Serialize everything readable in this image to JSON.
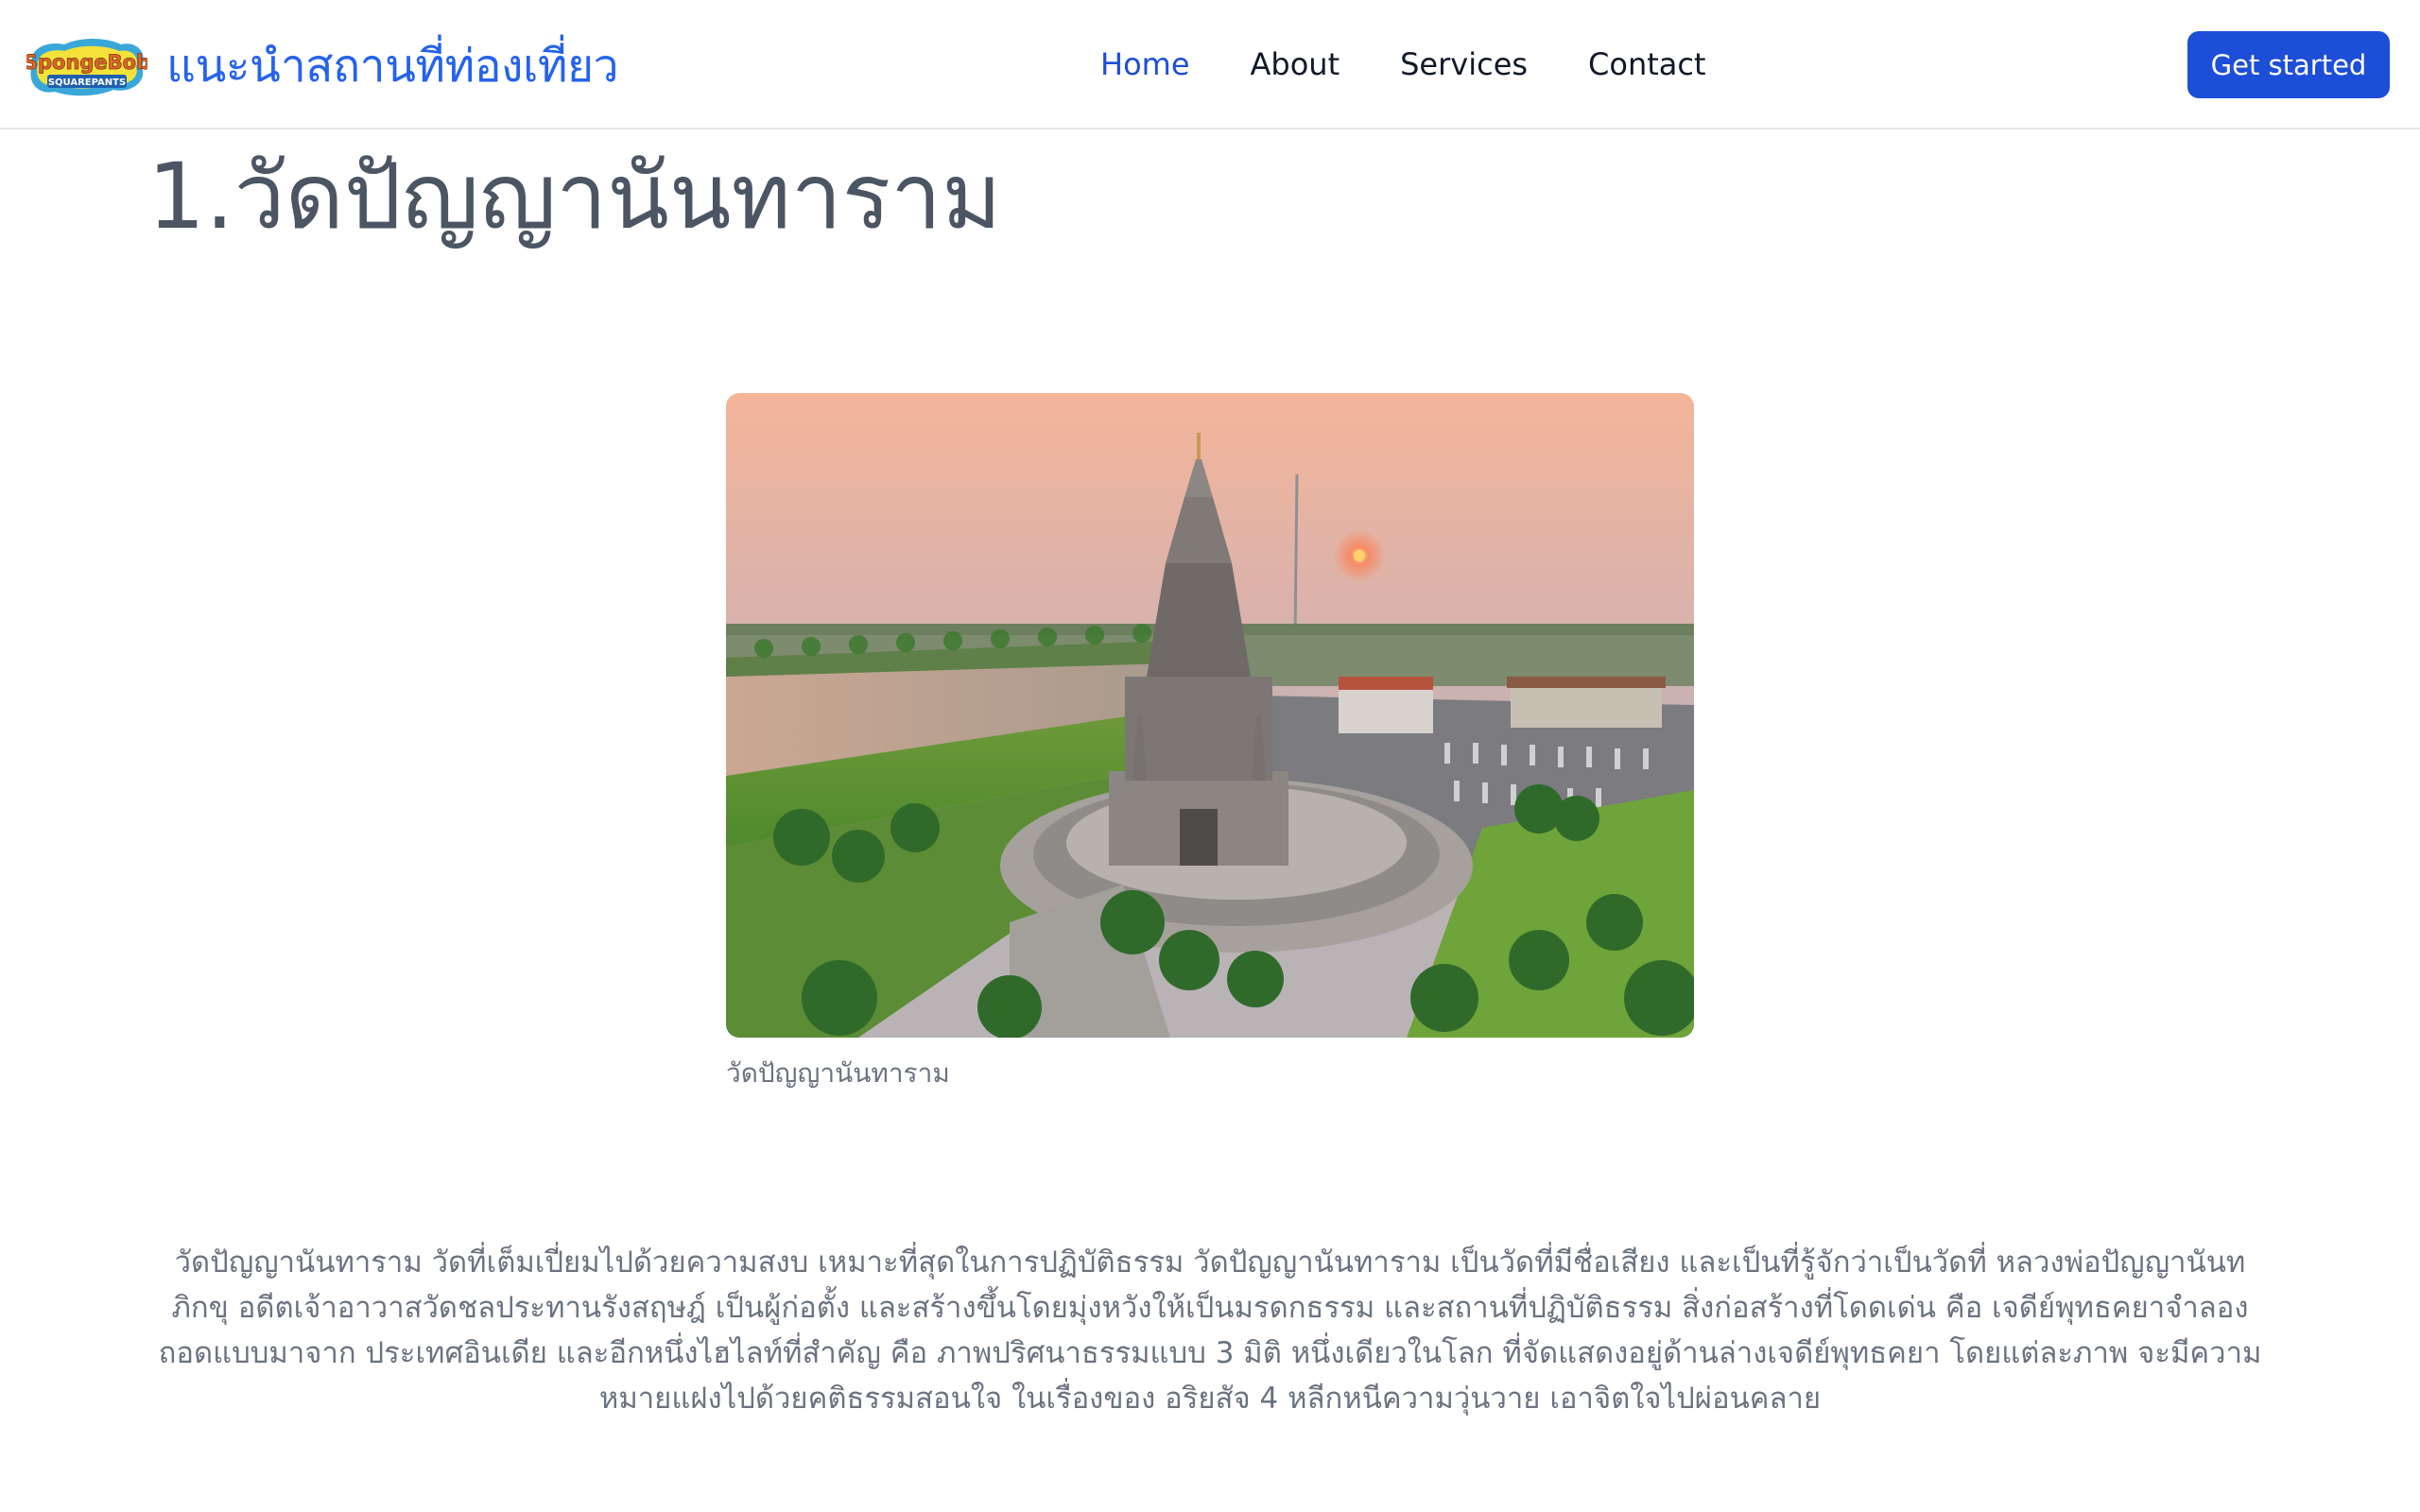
{
  "header": {
    "logo_icon": "spongebob-squarepants-logo",
    "logo_text_top": "SpongeBob",
    "logo_text_bottom": "SQUAREPANTS",
    "site_title": "แนะนำสถานที่ท่องเที่ยว",
    "nav": [
      {
        "label": "Home",
        "active": true
      },
      {
        "label": "About",
        "active": false
      },
      {
        "label": "Services",
        "active": false
      },
      {
        "label": "Contact",
        "active": false
      }
    ],
    "cta_label": "Get started"
  },
  "colors": {
    "accent": "#1d4ed8",
    "brand_title": "#2563eb",
    "heading": "#4b5563",
    "muted_text": "#6b7280"
  },
  "main": {
    "title": "1.วัดปัญญานันทาราม",
    "image_icon": "temple-photo",
    "caption": "วัดปัญญานันทาราม",
    "description": "วัดปัญญานันทาราม วัดที่เต็มเปี่ยมไปด้วยความสงบ เหมาะที่สุดในการปฏิบัติธรรม วัดปัญญานันทาราม เป็นวัดที่มีชื่อเสียง และเป็นที่รู้จักว่าเป็นวัดที่ หลวงพ่อปัญญานันทภิกขุ อดีตเจ้าอาวาสวัดชลประทานรังสฤษฎ์ เป็นผู้ก่อตั้ง และสร้างขึ้นโดยมุ่งหวังให้เป็นมรดกธรรม และสถานที่ปฏิบัติธรรม สิ่งก่อสร้างที่โดดเด่น คือ เจดีย์พุทธคยาจำลองถอดแบบมาจาก ประเทศอินเดีย และอีกหนึ่งไฮไลท์ที่สำคัญ คือ ภาพปริศนาธรรมแบบ 3 มิติ หนึ่งเดียวในโลก ที่จัดแสดงอยู่ด้านล่างเจดีย์พุทธคยา โดยแต่ละภาพ จะมีความหมายแฝงไปด้วยคติธรรมสอนใจ ในเรื่องของ อริยสัจ 4 หลีกหนีความวุ่นวาย เอาจิตใจไปผ่อนคลาย"
  }
}
